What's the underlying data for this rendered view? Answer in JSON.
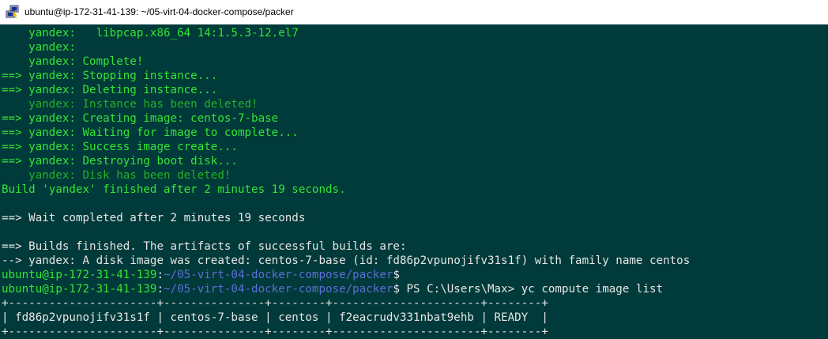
{
  "window": {
    "title": "ubuntu@ip-172-31-41-139: ~/05-virt-04-docker-compose/packer",
    "icon": "putty-icon"
  },
  "colors": {
    "terminal_bg": "#013a3a",
    "green": "#34e534",
    "dark_green": "#24b024",
    "white": "#e6e6e6",
    "blue": "#5a6fd6"
  },
  "terminal": {
    "lines": [
      [
        {
          "t": "    yandex:   libpcap.x86_64 14:1.5.3-12.el7",
          "c": "green"
        }
      ],
      [
        {
          "t": "    yandex:",
          "c": "green"
        }
      ],
      [
        {
          "t": "    yandex: Complete!",
          "c": "green"
        }
      ],
      [
        {
          "t": "==> yandex: Stopping instance...",
          "c": "green"
        }
      ],
      [
        {
          "t": "==> yandex: Deleting instance...",
          "c": "green"
        }
      ],
      [
        {
          "t": "    yandex: Instance has been deleted!",
          "c": "dark_green"
        }
      ],
      [
        {
          "t": "==> yandex: Creating image: centos-7-base",
          "c": "green"
        }
      ],
      [
        {
          "t": "==> yandex: Waiting for image to complete...",
          "c": "green"
        }
      ],
      [
        {
          "t": "==> yandex: Success image create...",
          "c": "green"
        }
      ],
      [
        {
          "t": "==> yandex: Destroying boot disk...",
          "c": "green"
        }
      ],
      [
        {
          "t": "    yandex: Disk has been deleted!",
          "c": "dark_green"
        }
      ],
      [
        {
          "t": "Build 'yandex' finished after 2 minutes 19 seconds.",
          "c": "green"
        }
      ],
      [
        {
          "t": "",
          "c": "white"
        }
      ],
      [
        {
          "t": "==> Wait completed after 2 minutes 19 seconds",
          "c": "white"
        }
      ],
      [
        {
          "t": "",
          "c": "white"
        }
      ],
      [
        {
          "t": "==> Builds finished. The artifacts of successful builds are:",
          "c": "white"
        }
      ],
      [
        {
          "t": "--> yandex: A disk image was created: centos-7-base (id: fd86p2vpunojifv31s1f) with family name centos",
          "c": "white"
        }
      ],
      [
        {
          "t": "ubuntu@ip-172-31-41-139",
          "c": "green"
        },
        {
          "t": ":",
          "c": "white"
        },
        {
          "t": "~/05-virt-04-docker-compose/packer",
          "c": "blue"
        },
        {
          "t": "$",
          "c": "white"
        }
      ],
      [
        {
          "t": "ubuntu@ip-172-31-41-139",
          "c": "green"
        },
        {
          "t": ":",
          "c": "white"
        },
        {
          "t": "~/05-virt-04-docker-compose/packer",
          "c": "blue"
        },
        {
          "t": "$ PS C:\\Users\\Max> yc compute image list",
          "c": "white"
        }
      ],
      [
        {
          "t": "+----------------------+---------------+--------+----------------------+--------+",
          "c": "white"
        }
      ],
      [
        {
          "t": "| fd86p2vpunojifv31s1f | centos-7-base | centos | f2eacrudv331nbat9ehb | READY  |",
          "c": "white"
        }
      ],
      [
        {
          "t": "+----------------------+---------------+--------+----------------------+--------+",
          "c": "white"
        }
      ]
    ]
  }
}
